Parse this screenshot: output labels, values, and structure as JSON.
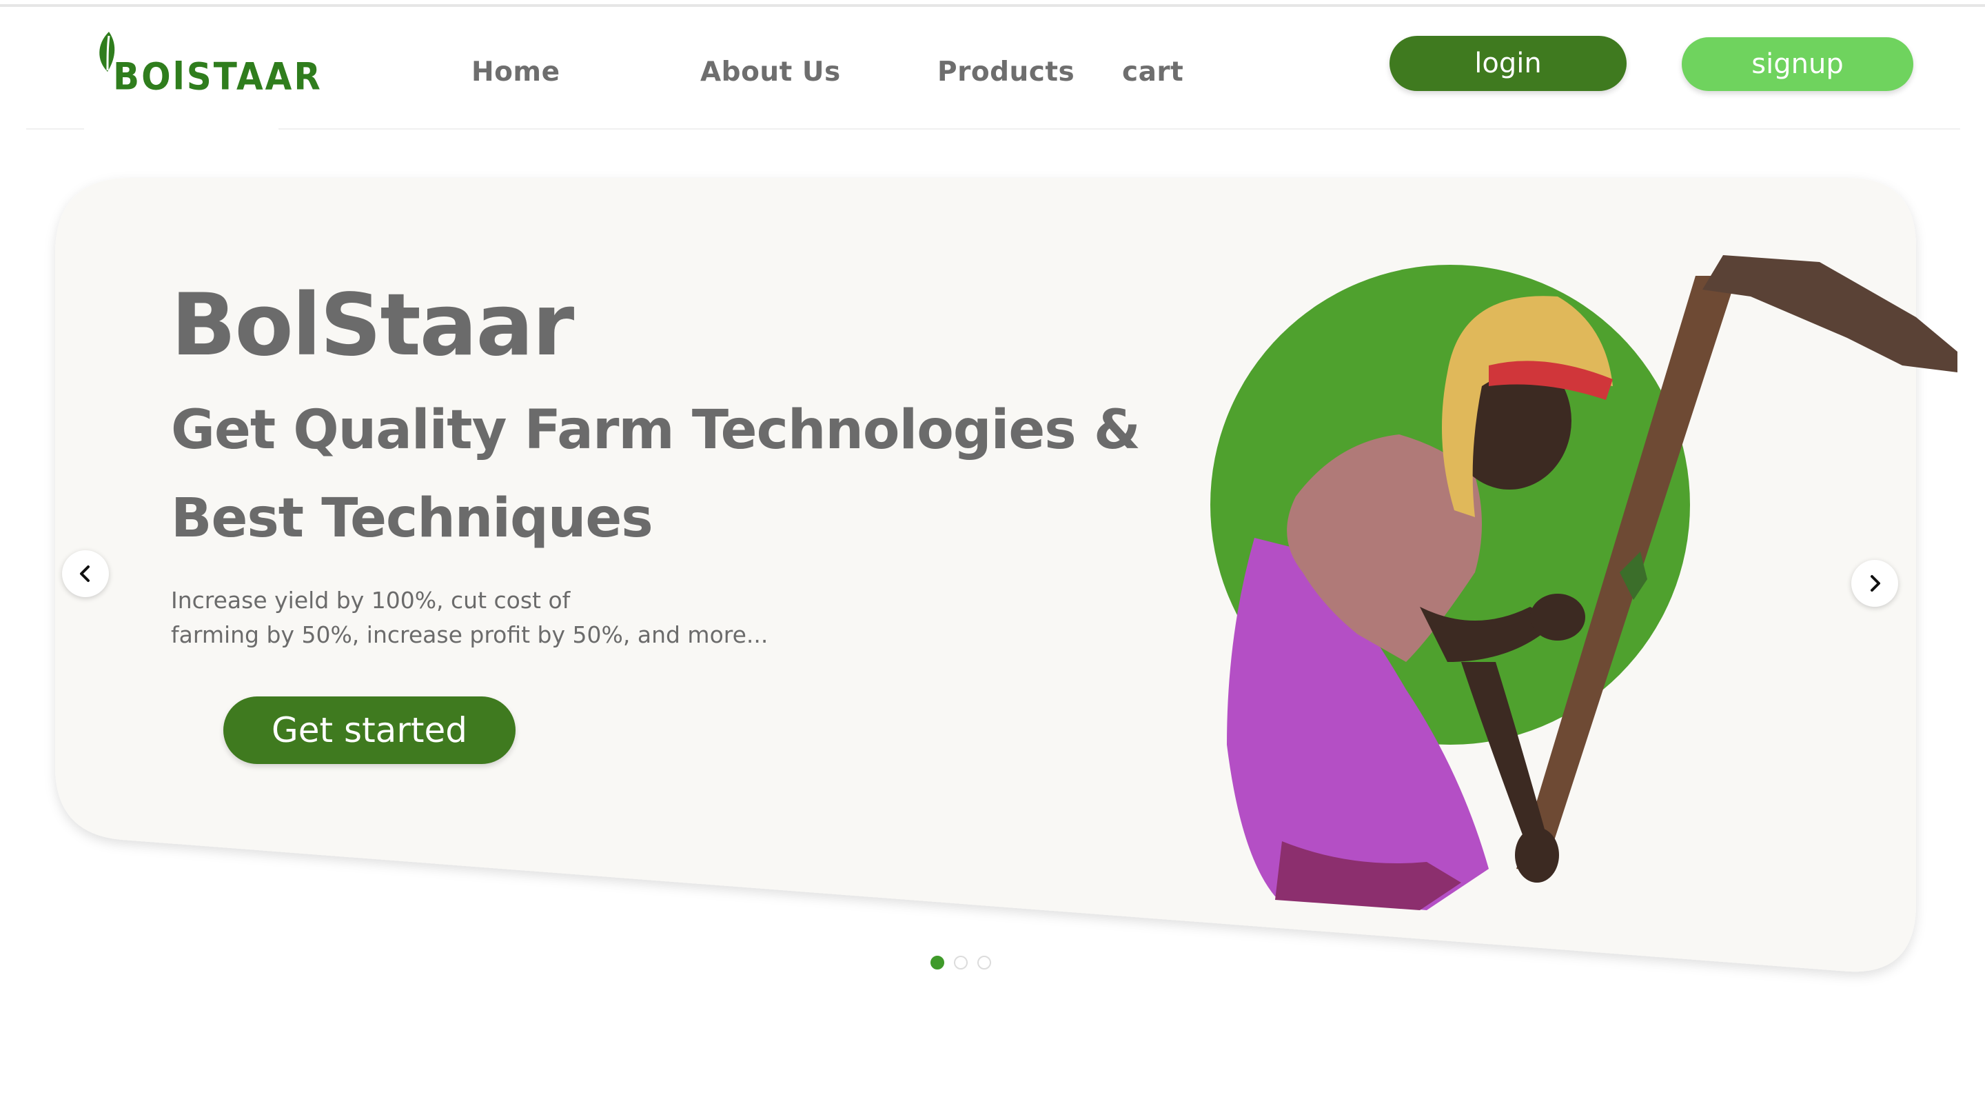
{
  "brand": {
    "logo_text": "BOlSTAAR",
    "color": "#2f7d1d"
  },
  "nav": {
    "items": [
      {
        "label": "Home"
      },
      {
        "label": "About Us"
      },
      {
        "label": "Products"
      },
      {
        "label": "cart"
      }
    ]
  },
  "auth": {
    "login_label": "login",
    "signup_label": "signup",
    "login_color": "#3f7a1f",
    "signup_color": "#6fd35e"
  },
  "hero": {
    "title": "BolStaar",
    "subtitle_line1": "Get Quality Farm Technologies &",
    "subtitle_line2": "Best Techniques",
    "description_line1": "Increase yield by 100%, cut cost of",
    "description_line2": "farming by 50%, increase profit by 50%, and more...",
    "cta_label": "Get started",
    "accent_circle_color": "#4fa12e",
    "card_color": "#f9f8f5",
    "image": "farmer-with-hoe-illustration"
  },
  "carousel": {
    "prev_icon": "chevron-left-icon",
    "next_icon": "chevron-right-icon",
    "slide_count": 3,
    "active_slide": 1
  }
}
